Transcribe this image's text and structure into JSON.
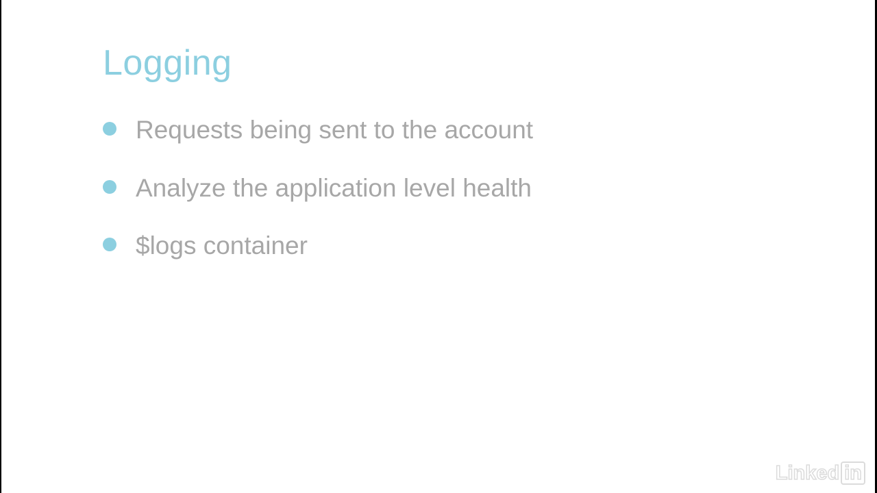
{
  "slide": {
    "title": "Logging",
    "bullets": [
      "Requests being sent to the account",
      "Analyze the application level health",
      "$logs container"
    ],
    "accent_color": "#8ccfe0",
    "text_color": "#a7a7a7"
  },
  "watermark": {
    "text": "Linked",
    "box_text": "in"
  }
}
